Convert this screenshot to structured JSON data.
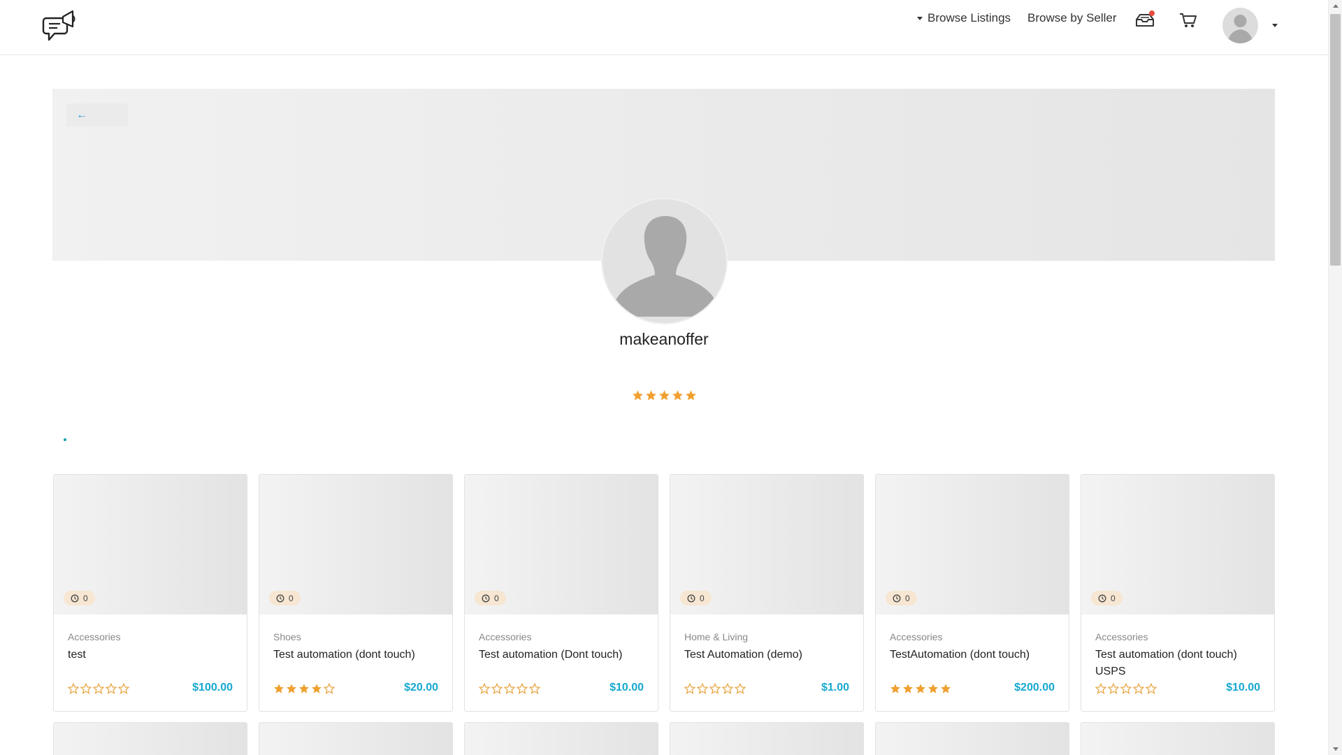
{
  "nav": {
    "browse_listings": "Browse Listings",
    "browse_by_seller": "Browse by Seller"
  },
  "back": {
    "label": "←"
  },
  "profile": {
    "username": "makeanoffer",
    "rating": 5
  },
  "colors": {
    "accent": "#17a8d0",
    "star": "#f0a030",
    "star_empty": "#e8a84a",
    "notification": "#e74c3c"
  },
  "listings": [
    {
      "category": "Accessories",
      "title": "test",
      "price": "$100.00",
      "rating": 0,
      "badge": "0"
    },
    {
      "category": "Shoes",
      "title": "Test automation (dont touch)",
      "price": "$20.00",
      "rating": 4,
      "badge": "0"
    },
    {
      "category": "Accessories",
      "title": "Test automation (Dont touch)",
      "price": "$10.00",
      "rating": 0,
      "badge": "0"
    },
    {
      "category": "Home & Living",
      "title": "Test Automation (demo)",
      "price": "$1.00",
      "rating": 0,
      "badge": "0"
    },
    {
      "category": "Accessories",
      "title": "TestAutomation (dont touch)",
      "price": "$200.00",
      "rating": 5,
      "badge": "0"
    },
    {
      "category": "Accessories",
      "title": "Test automation (dont touch) USPS",
      "price": "$10.00",
      "rating": 0,
      "badge": "0"
    }
  ]
}
